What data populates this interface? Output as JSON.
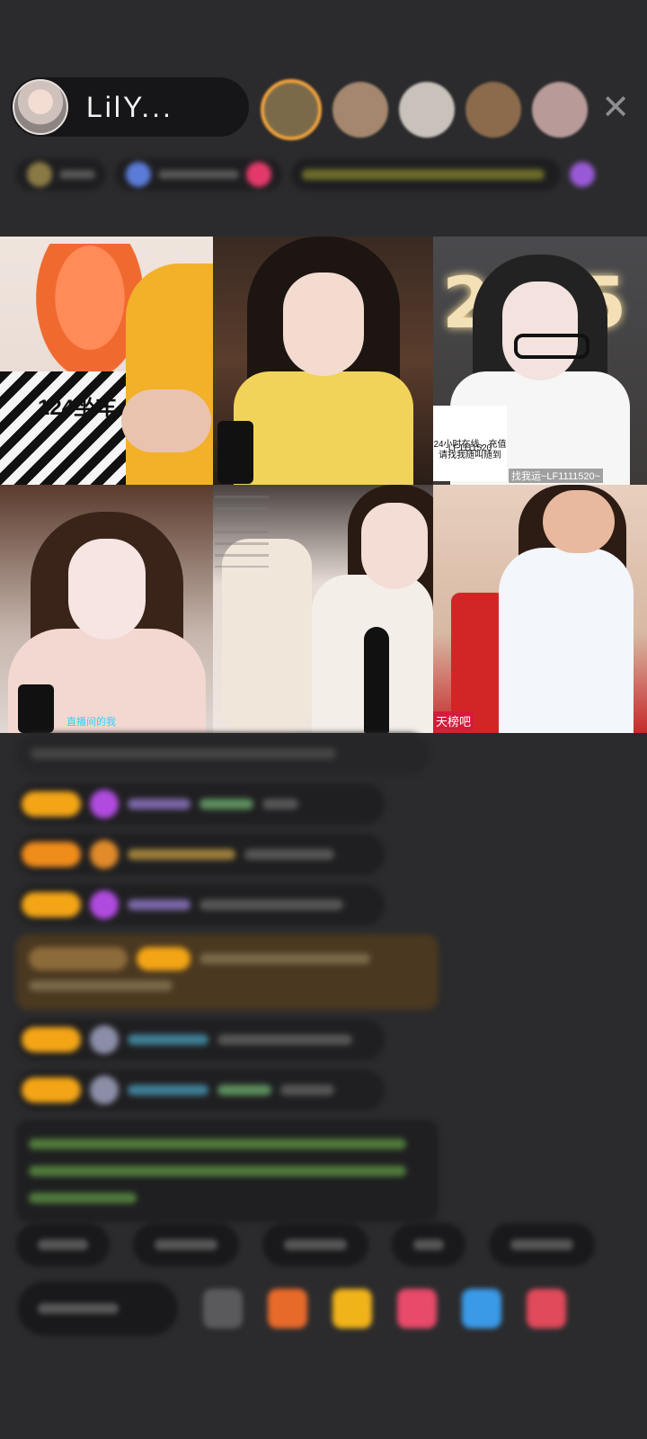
{
  "host": {
    "name": "LilY..."
  },
  "viewers": [
    {
      "name": "viewer-1",
      "color": "#7b6a4a"
    },
    {
      "name": "viewer-2",
      "color": "#a5876f"
    },
    {
      "name": "viewer-3",
      "color": "#c9c2bb"
    },
    {
      "name": "viewer-4",
      "color": "#8c6a4c"
    },
    {
      "name": "viewer-5",
      "color": "#b89a98"
    }
  ],
  "close_icon": "close-icon",
  "grid": {
    "tiles": [
      {
        "label": "124坐车"
      },
      {
        "label": ""
      },
      {
        "label": "24小时在线，充值请找我随叫随到",
        "card_label": "LF1111520",
        "bottom_tag": "找我运~LF1111520~"
      },
      {
        "label": "直播间的我"
      },
      {
        "label": ""
      },
      {
        "label": "天榜吧"
      }
    ]
  },
  "colors": {
    "background": "#2b2b2d",
    "pill": "#161618",
    "badge_gold": "#f3a516",
    "viewer_ring": "#f2a33a"
  }
}
